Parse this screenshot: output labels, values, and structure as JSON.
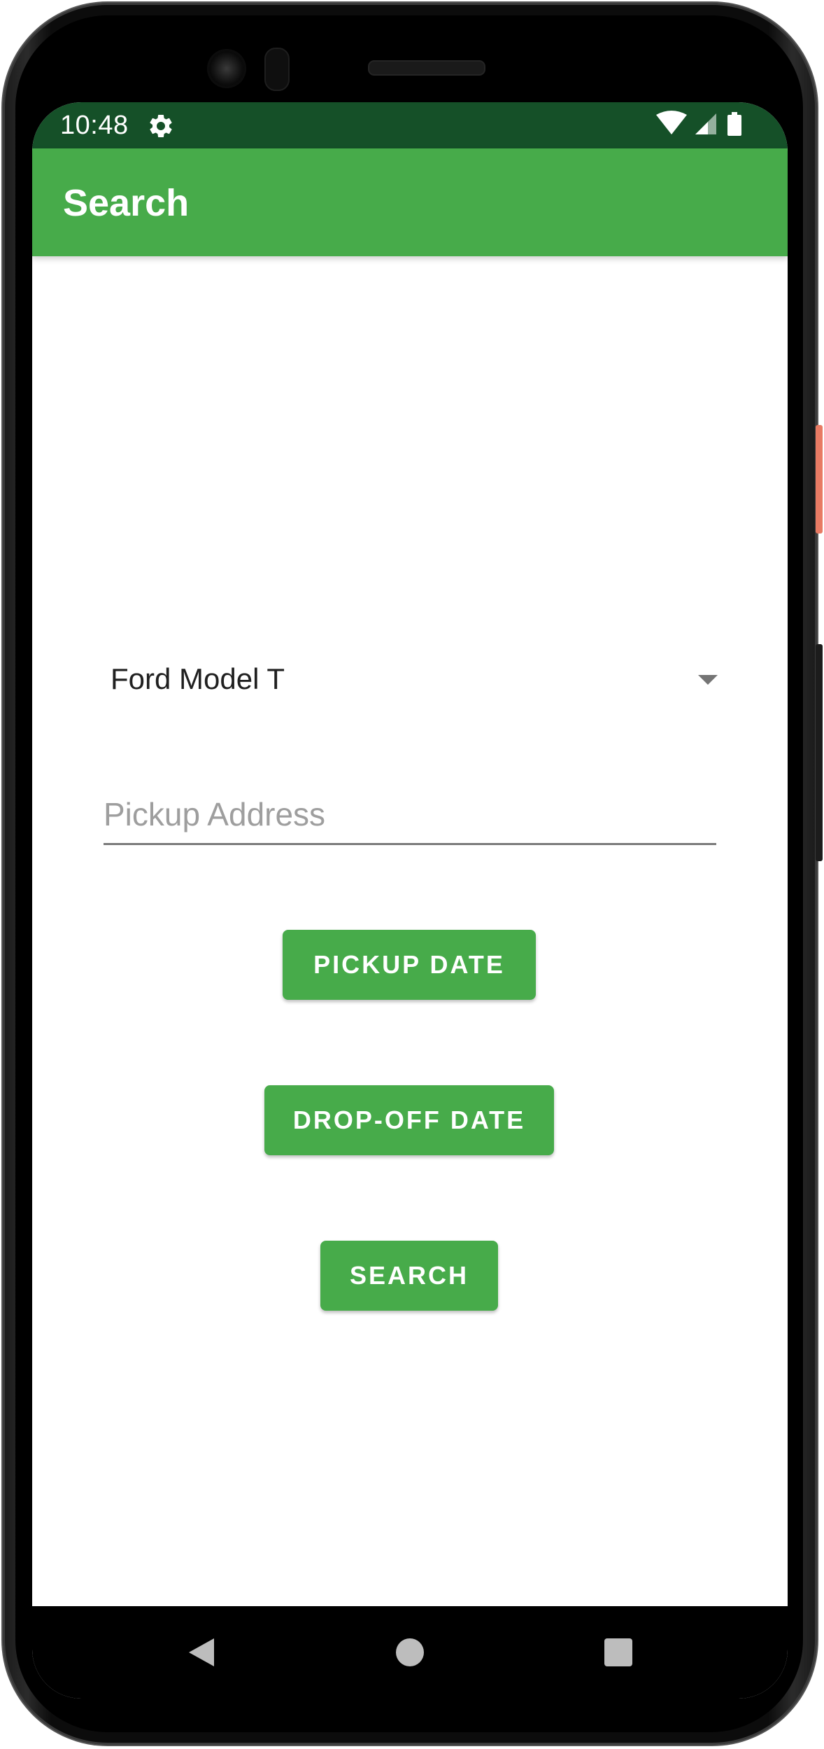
{
  "status_bar": {
    "time": "10:48",
    "icons": [
      "gear-icon",
      "wifi-icon",
      "cellular-signal-icon",
      "battery-icon"
    ],
    "background_color": "#155028"
  },
  "app_bar": {
    "title": "Search",
    "background_color": "#47ab4a"
  },
  "form": {
    "car_spinner": {
      "selected_value": "Ford Model T"
    },
    "pickup_address": {
      "value": "",
      "placeholder": "Pickup Address"
    },
    "pickup_date_button": "PICKUP DATE",
    "dropoff_date_button": "DROP-OFF DATE",
    "search_button": "SEARCH",
    "accent_color": "#47ab4a"
  },
  "nav_bar": {
    "icons": [
      "back-icon",
      "home-icon",
      "recents-icon"
    ]
  }
}
